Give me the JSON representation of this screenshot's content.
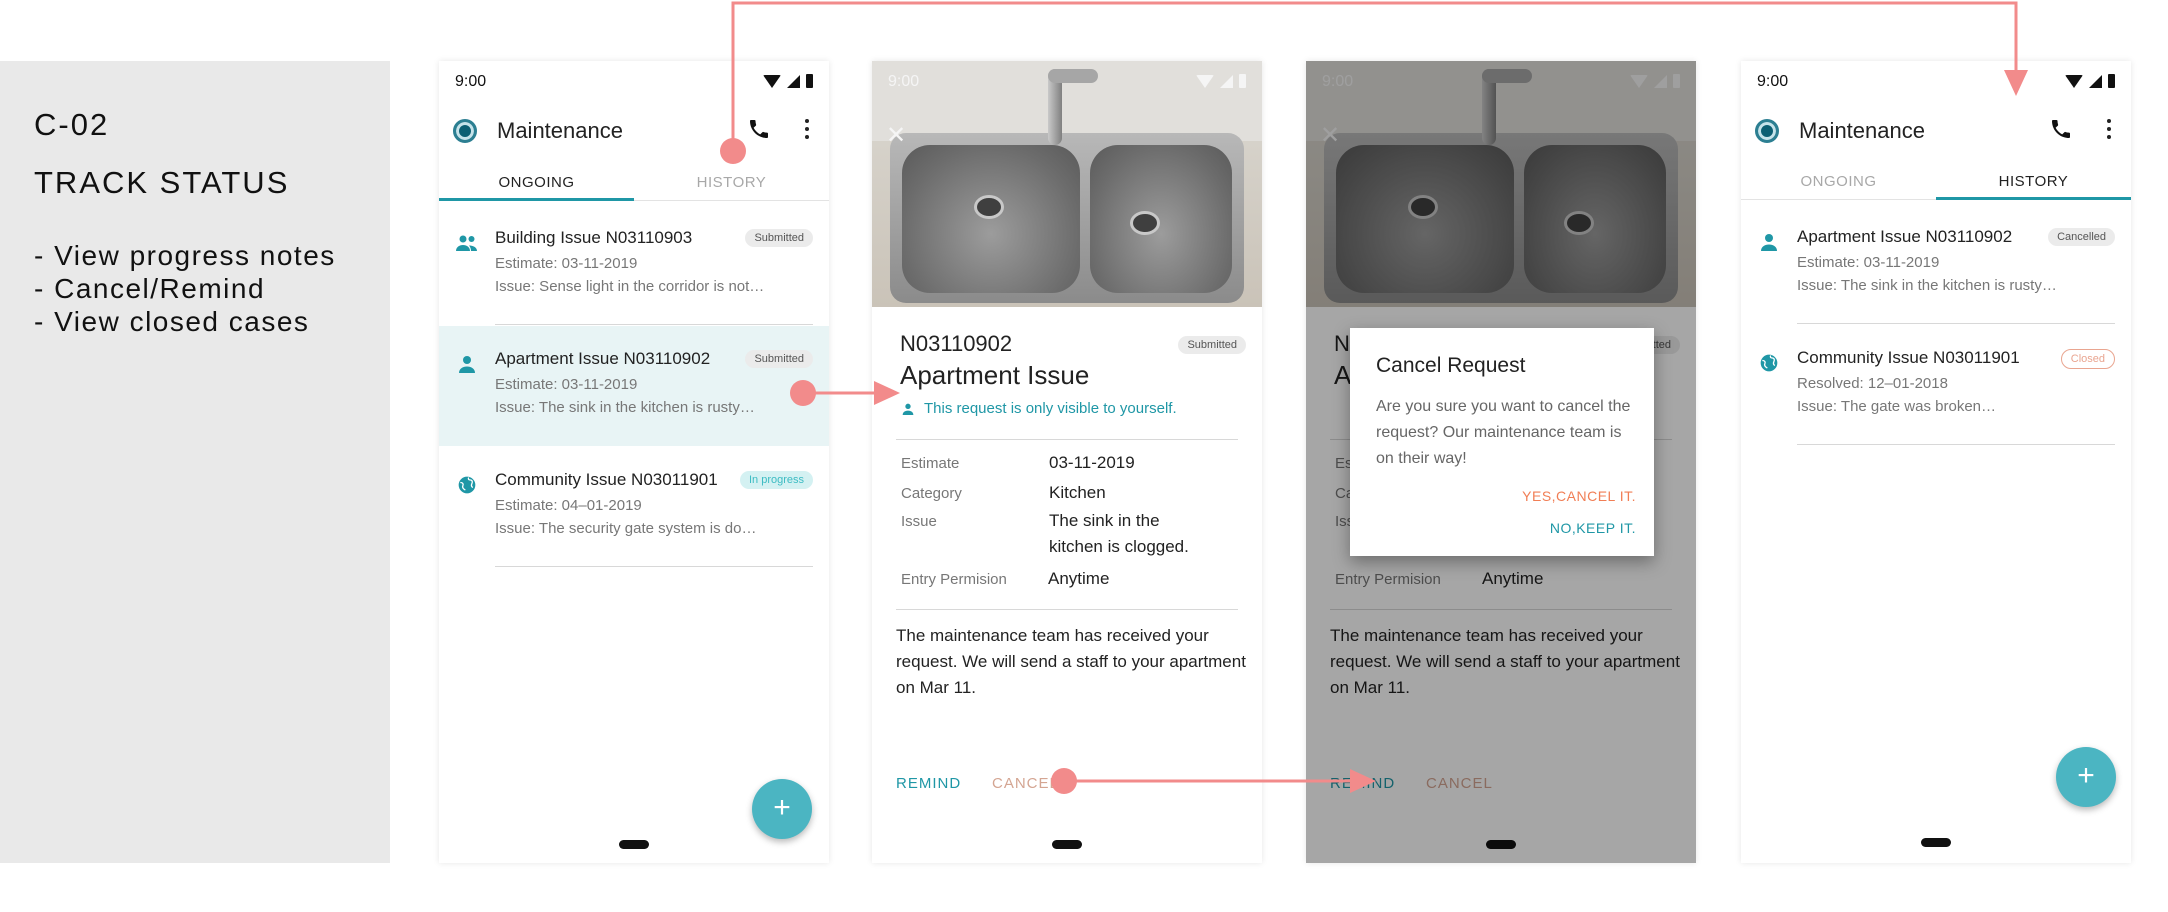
{
  "sidebar": {
    "code": "C-02",
    "title": "TRACK STATUS",
    "bullets": [
      "- View progress notes",
      "- Cancel/Remind",
      "- View closed cases"
    ]
  },
  "status_time": "9:00",
  "app_title": "Maintenance",
  "tabs": {
    "ongoing": "ONGOING",
    "history": "HISTORY"
  },
  "ongoing_list": [
    {
      "title": "Building Issue N03110903",
      "line2": "Estimate: 03-11-2019",
      "line3": "Issue: Sense light in the corridor is not…",
      "badge": "Submitted",
      "icon": "group-icon"
    },
    {
      "title": "Apartment Issue N03110902",
      "line2": "Estimate: 03-11-2019",
      "line3": "Issue: The sink in the kitchen is rusty…",
      "badge": "Submitted",
      "icon": "person-icon"
    },
    {
      "title": "Community Issue N03011901",
      "line2": "Estimate: 04–01-2019",
      "line3": "Issue: The security gate system is do…",
      "badge": "In progress",
      "icon": "globe-icon"
    }
  ],
  "history_list": [
    {
      "title": "Apartment Issue N03110902",
      "line2": "Estimate: 03-11-2019",
      "line3": "Issue: The sink in the kitchen is rusty…",
      "badge": "Cancelled",
      "icon": "person-icon"
    },
    {
      "title": "Community Issue N03011901",
      "line2": "Resolved: 12–01-2018",
      "line3": "Issue: The gate was broken…",
      "badge": "Closed",
      "icon": "globe-icon"
    }
  ],
  "detail": {
    "id": "N03110902",
    "title": "Apartment Issue",
    "badge": "Submitted",
    "note": "This request is only visible to yourself.",
    "rows": [
      {
        "label": "Estimate",
        "value": "03-11-2019"
      },
      {
        "label": "Category",
        "value": "Kitchen"
      },
      {
        "label": "Issue",
        "value": "The sink in the kitchen is clogged."
      },
      {
        "label": "Entry Permision",
        "value": "Anytime"
      }
    ],
    "issue_line1": "The sink in the",
    "issue_line2": "kitchen is clogged.",
    "message": "The maintenance team has received your request. We will send a staff to your apartment on Mar 11.",
    "remind": "REMIND",
    "cancel": "CANCEL"
  },
  "dialog": {
    "title": "Cancel Request",
    "body": "Are you sure you want to cancel the request? Our maintenance team is on their way!",
    "yes": "YES,CANCEL IT.",
    "no": "NO,KEEP IT."
  },
  "fab": "+",
  "colors": {
    "accent": "#1f97a6",
    "selected_row": "#e8f4f5",
    "cancel": "#d4a592",
    "arrow": "#f28b8b",
    "dialog_yes": "#f17e55"
  }
}
